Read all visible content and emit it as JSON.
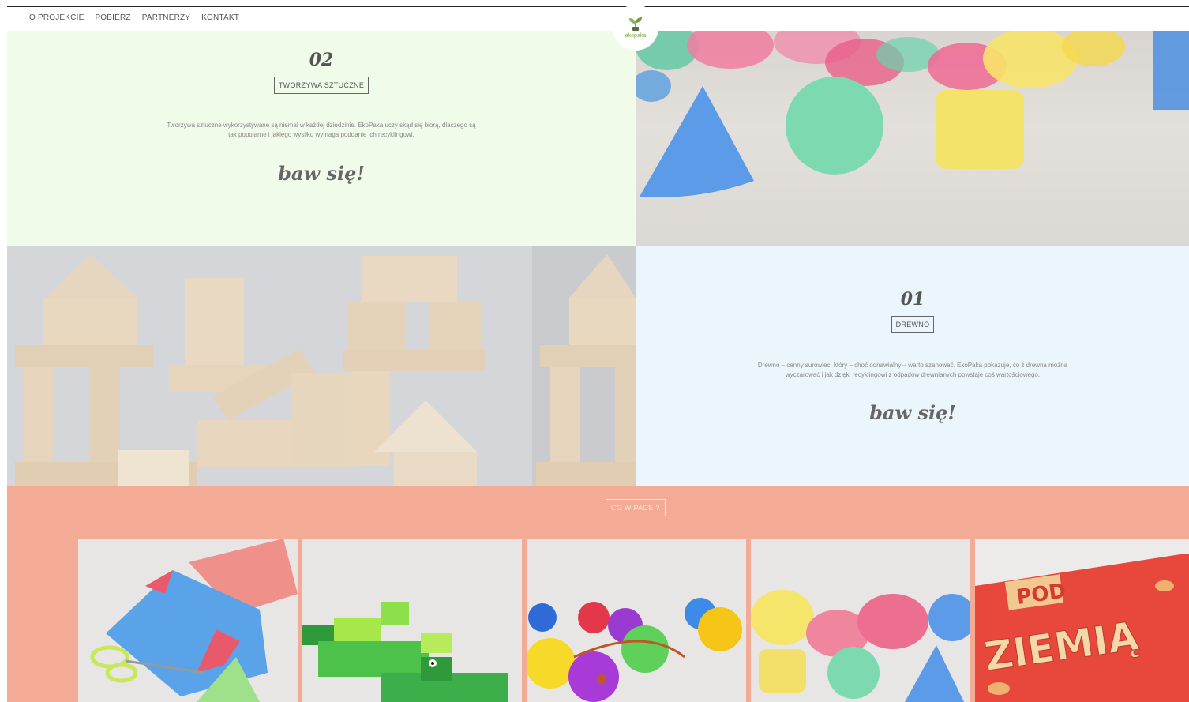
{
  "nav": {
    "items": [
      "O PROJEKCIE",
      "POBIERZ",
      "PARTNERZY",
      "KONTAKT"
    ]
  },
  "logo": {
    "text": "ekopaka"
  },
  "section_plastics": {
    "number": "02",
    "tag": "TWORZYWA SZTUCZNE",
    "desc_line1": "Tworzywa sztuczne wykorzystywane są niemal w każdej dziedzinie. EkoPaka uczy skąd się biorą, dlaczego są",
    "desc_line2": "tak popularne i jakiego wysiłku wymaga poddanie ich recyklingowi.",
    "cta": "baw się!"
  },
  "section_wood": {
    "number": "01",
    "tag": "DREWNO",
    "desc_line1": "Drewno – cenny surowiec, który – choć odnawialny – warto szanować. EkoPaka pokazuje, co z drewna można",
    "desc_line2": "wyczarować i jak dzięki recyklingowi z odpadów drewnianych powstaje coś wartościowego.",
    "cta": "baw się!"
  },
  "package": {
    "tag": "CO W PACE ?",
    "book_title_top": "POD",
    "book_title_main": "ZIEMIĄ"
  },
  "colors": {
    "green_bg": "#f1fbe9",
    "blue_bg": "#eaf6fb",
    "salmon_bg": "#f4ab96",
    "text_gray": "#555555"
  }
}
